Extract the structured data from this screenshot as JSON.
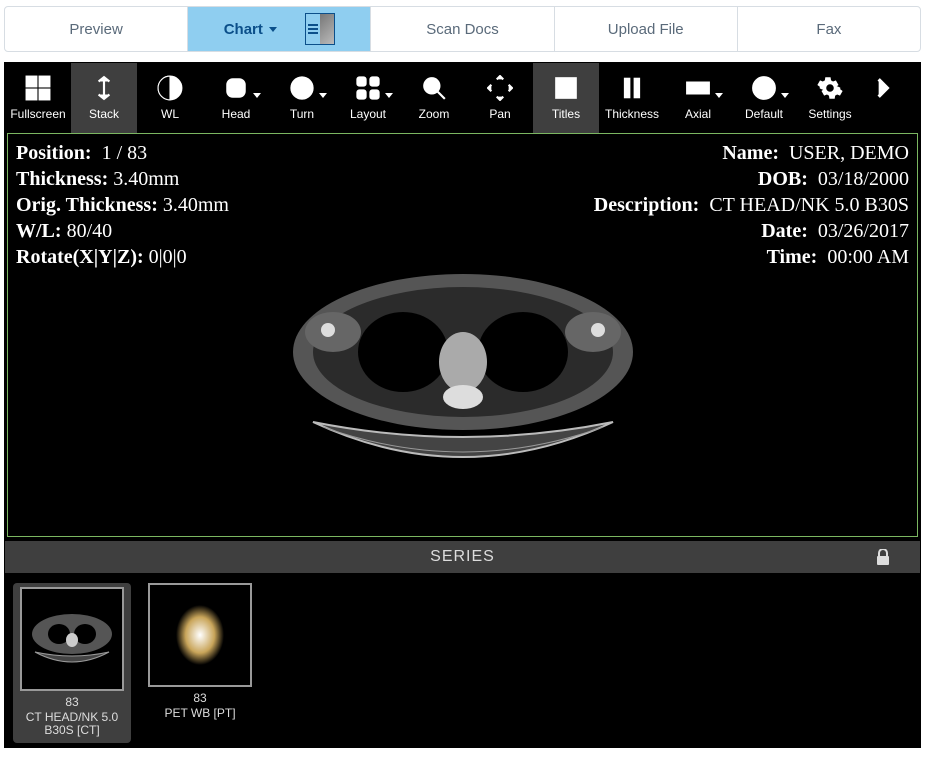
{
  "tabs": {
    "preview": "Preview",
    "chart": "Chart",
    "scandocs": "Scan Docs",
    "upload": "Upload File",
    "fax": "Fax"
  },
  "toolbar": {
    "fullscreen": "Fullscreen",
    "stack": "Stack",
    "wl": "WL",
    "head": "Head",
    "turn": "Turn",
    "layout": "Layout",
    "zoom": "Zoom",
    "pan": "Pan",
    "titles": "Titles",
    "thickness": "Thickness",
    "axial": "Axial",
    "default": "Default",
    "settings": "Settings"
  },
  "overlay_left": {
    "position_label": "Position:",
    "position_value": "1 / 83",
    "thickness_label": "Thickness:",
    "thickness_value": "3.40mm",
    "orig_thickness_label": "Orig. Thickness:",
    "orig_thickness_value": "3.40mm",
    "wl_label": "W/L:",
    "wl_value": "80/40",
    "rotate_label": "Rotate(X|Y|Z):",
    "rotate_value": "0|0|0"
  },
  "overlay_right": {
    "name_label": "Name:",
    "name_value": "USER, DEMO",
    "dob_label": "DOB:",
    "dob_value": "03/18/2000",
    "desc_label": "Description:",
    "desc_value": "CT HEAD/NK 5.0 B30S",
    "date_label": "Date:",
    "date_value": "03/26/2017",
    "time_label": "Time:",
    "time_value": "00:00 AM"
  },
  "series_label": "SERIES",
  "thumbnails": [
    {
      "count": "83",
      "name": "CT HEAD/NK 5.0 B30S [CT]"
    },
    {
      "count": "83",
      "name": "PET WB [PT]"
    }
  ]
}
